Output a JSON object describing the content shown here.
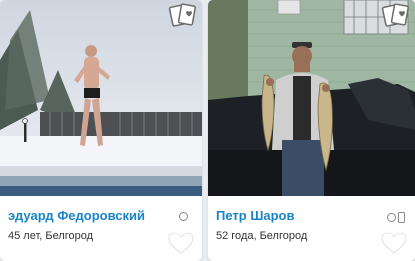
{
  "cards": [
    {
      "name": "эдуард Федоровский",
      "details": "45 лет, Белгород",
      "status": "offline-icon",
      "badge": "cards-icon",
      "favorite": "heart-icon"
    },
    {
      "name": "Петр Шаров",
      "details": "52 года, Белгород",
      "status": "offline-mobile-icon",
      "badge": "cards-icon",
      "favorite": "heart-icon"
    }
  ],
  "colors": {
    "name_link": "#1a84c6",
    "status_icon": "#8a8a8a",
    "page_bg": "#e9edf2"
  }
}
